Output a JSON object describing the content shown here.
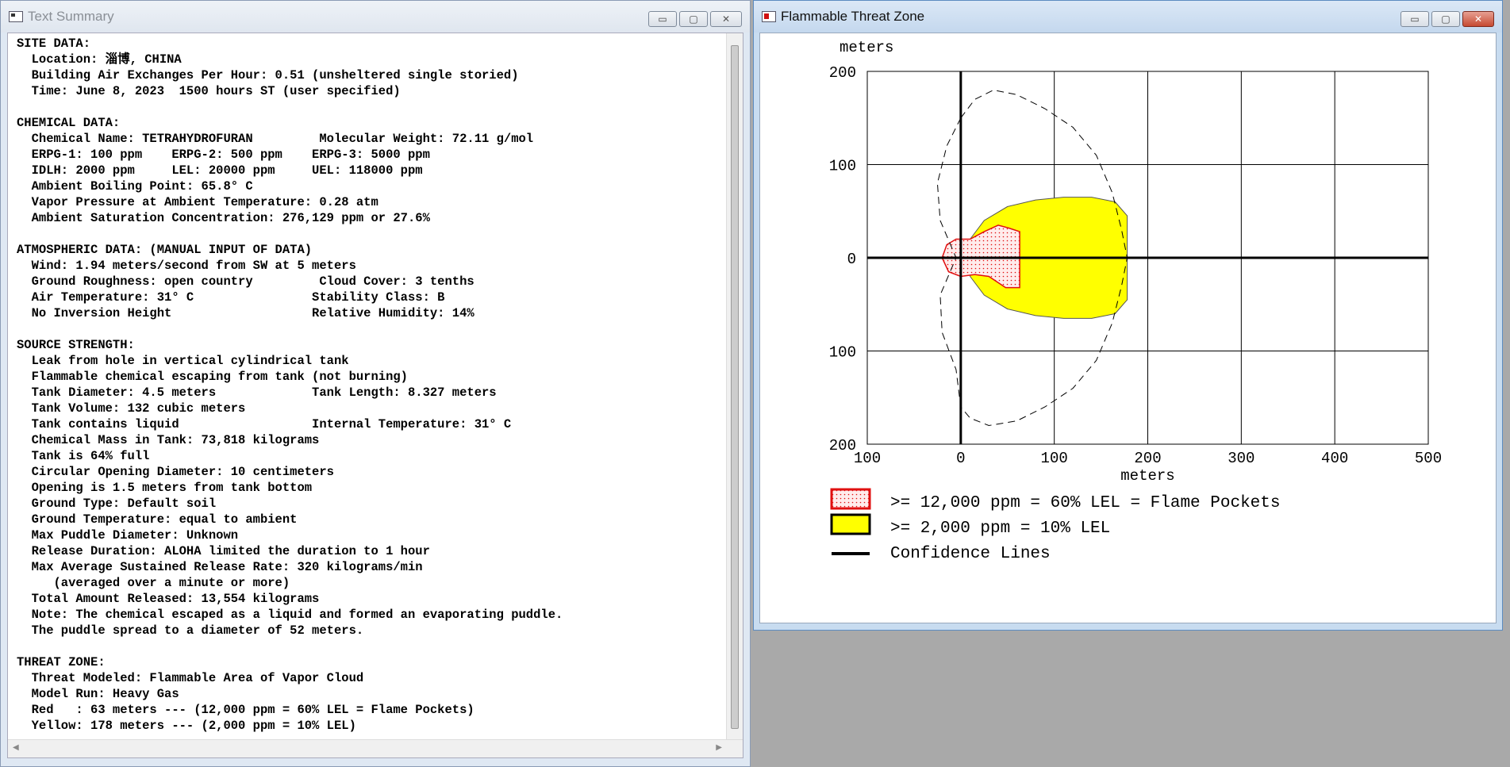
{
  "text_window": {
    "title": "Text Summary",
    "controls": [
      "▭",
      "▢",
      "✕"
    ],
    "summary_lines": [
      "SITE DATA:",
      "  Location: 淄博, CHINA",
      "  Building Air Exchanges Per Hour: 0.51 (unsheltered single storied)",
      "  Time: June 8, 2023  1500 hours ST (user specified)",
      "",
      "CHEMICAL DATA:",
      "  Chemical Name: TETRAHYDROFURAN         Molecular Weight: 72.11 g/mol",
      "  ERPG-1: 100 ppm    ERPG-2: 500 ppm    ERPG-3: 5000 ppm",
      "  IDLH: 2000 ppm     LEL: 20000 ppm     UEL: 118000 ppm",
      "  Ambient Boiling Point: 65.8° C",
      "  Vapor Pressure at Ambient Temperature: 0.28 atm",
      "  Ambient Saturation Concentration: 276,129 ppm or 27.6%",
      "",
      "ATMOSPHERIC DATA: (MANUAL INPUT OF DATA)",
      "  Wind: 1.94 meters/second from SW at 5 meters",
      "  Ground Roughness: open country         Cloud Cover: 3 tenths",
      "  Air Temperature: 31° C                Stability Class: B",
      "  No Inversion Height                   Relative Humidity: 14%",
      "",
      "SOURCE STRENGTH:",
      "  Leak from hole in vertical cylindrical tank",
      "  Flammable chemical escaping from tank (not burning)",
      "  Tank Diameter: 4.5 meters             Tank Length: 8.327 meters",
      "  Tank Volume: 132 cubic meters",
      "  Tank contains liquid                  Internal Temperature: 31° C",
      "  Chemical Mass in Tank: 73,818 kilograms",
      "  Tank is 64% full",
      "  Circular Opening Diameter: 10 centimeters",
      "  Opening is 1.5 meters from tank bottom",
      "  Ground Type: Default soil",
      "  Ground Temperature: equal to ambient",
      "  Max Puddle Diameter: Unknown",
      "  Release Duration: ALOHA limited the duration to 1 hour",
      "  Max Average Sustained Release Rate: 320 kilograms/min",
      "     (averaged over a minute or more)",
      "  Total Amount Released: 13,554 kilograms",
      "  Note: The chemical escaped as a liquid and formed an evaporating puddle.",
      "  The puddle spread to a diameter of 52 meters.",
      "",
      "THREAT ZONE:",
      "  Threat Modeled: Flammable Area of Vapor Cloud",
      "  Model Run: Heavy Gas",
      "  Red   : 63 meters --- (12,000 ppm = 60% LEL = Flame Pockets)",
      "  Yellow: 178 meters --- (2,000 ppm = 10% LEL)"
    ]
  },
  "plot_window": {
    "title": "Flammable Threat Zone",
    "controls": [
      "▭",
      "▢",
      "✕"
    ]
  },
  "chart_data": {
    "type": "area",
    "x_label": "meters",
    "y_label": "meters",
    "x_range": [
      -100,
      500
    ],
    "y_range": [
      -200,
      200
    ],
    "x_ticks": [
      -100,
      0,
      100,
      200,
      300,
      400,
      500
    ],
    "x_tick_labels": [
      "100",
      "0",
      "100",
      "200",
      "300",
      "400",
      "500"
    ],
    "y_ticks": [
      200,
      100,
      0,
      -100,
      -200
    ],
    "y_tick_labels": [
      "200",
      "100",
      "0",
      "100",
      "200"
    ],
    "grid": true,
    "colors": {
      "red_zone": "#e01010",
      "yellow_zone": "#ffff00",
      "line": "#000000"
    },
    "series": [
      {
        "name": ">= 2,000 ppm = 10% LEL",
        "fill": "#ffff00",
        "outline": [
          [
            10,
            20
          ],
          [
            25,
            40
          ],
          [
            50,
            55
          ],
          [
            80,
            62
          ],
          [
            110,
            65
          ],
          [
            140,
            65
          ],
          [
            165,
            60
          ],
          [
            178,
            45
          ],
          [
            178,
            -45
          ],
          [
            165,
            -60
          ],
          [
            140,
            -65
          ],
          [
            110,
            -65
          ],
          [
            80,
            -62
          ],
          [
            50,
            -55
          ],
          [
            25,
            -40
          ],
          [
            10,
            -20
          ]
        ]
      },
      {
        "name": ">= 12,000 ppm = 60% LEL = Flame Pockets",
        "fill": "#ffe4e4",
        "outline": [
          [
            -20,
            0
          ],
          [
            -15,
            14
          ],
          [
            -5,
            20
          ],
          [
            10,
            20
          ],
          [
            25,
            28
          ],
          [
            40,
            35
          ],
          [
            51,
            32
          ],
          [
            63,
            28
          ],
          [
            63,
            -32
          ],
          [
            48,
            -32
          ],
          [
            30,
            -20
          ],
          [
            15,
            -18
          ],
          [
            0,
            -20
          ],
          [
            -13,
            -15
          ]
        ]
      },
      {
        "name": "Confidence Lines",
        "fill": "none",
        "outline": [
          [
            0,
            150
          ],
          [
            15,
            170
          ],
          [
            35,
            180
          ],
          [
            60,
            175
          ],
          [
            90,
            160
          ],
          [
            120,
            140
          ],
          [
            145,
            110
          ],
          [
            162,
            70
          ],
          [
            172,
            30
          ],
          [
            178,
            0
          ],
          [
            172,
            -30
          ],
          [
            162,
            -70
          ],
          [
            145,
            -110
          ],
          [
            120,
            -140
          ],
          [
            90,
            -160
          ],
          [
            60,
            -175
          ],
          [
            30,
            -180
          ],
          [
            10,
            -172
          ],
          [
            0,
            -160
          ],
          [
            -5,
            -120
          ],
          [
            -20,
            -80
          ],
          [
            -22,
            -40
          ],
          [
            -5,
            0
          ],
          [
            -22,
            40
          ],
          [
            -25,
            80
          ],
          [
            -15,
            120
          ],
          [
            0,
            150
          ]
        ]
      }
    ],
    "legend": [
      {
        "label": ">= 12,000 ppm = 60% LEL = Flame Pockets",
        "swatch": "red"
      },
      {
        "label": ">= 2,000 ppm = 10% LEL",
        "swatch": "yellow"
      },
      {
        "label": "Confidence Lines",
        "swatch": "line"
      }
    ]
  }
}
